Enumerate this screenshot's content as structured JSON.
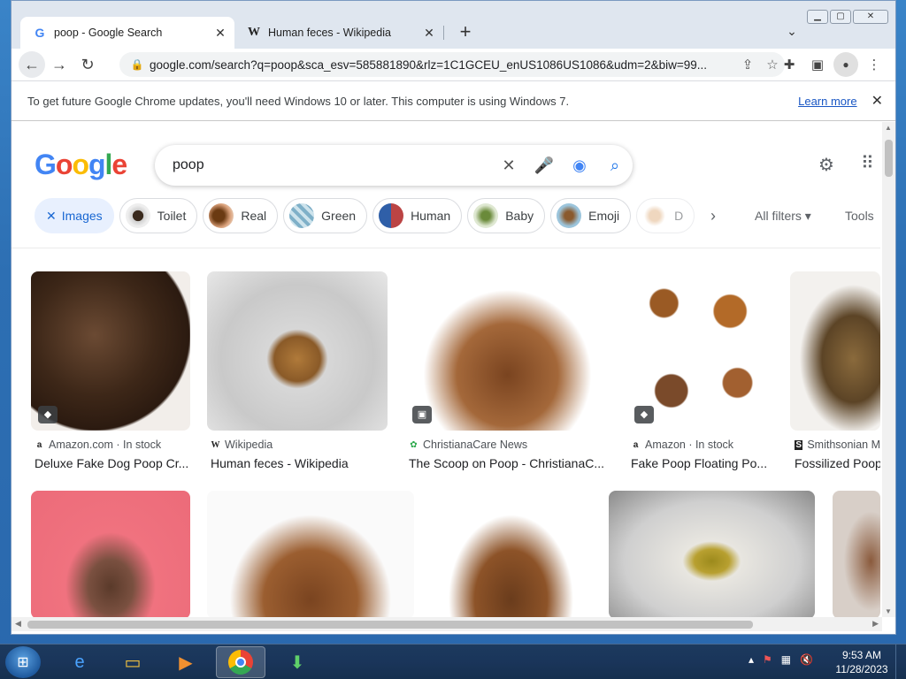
{
  "browser": {
    "tabs": [
      {
        "title": "poop - Google Search",
        "favicon": "G"
      },
      {
        "title": "Human feces - Wikipedia",
        "favicon": "W"
      }
    ],
    "url": "google.com/search?q=poop&sca_esv=585881890&rlz=1C1GCEU_enUS1086US1086&udm=2&biw=99...",
    "window_controls": [
      "_",
      "□",
      "✕"
    ]
  },
  "infobar": {
    "message": "To get future Google Chrome updates, you'll need Windows 10 or later. This computer is using Windows 7.",
    "link": "Learn more"
  },
  "search": {
    "query": "poop",
    "logo": "Google"
  },
  "chips": [
    {
      "label": "Images",
      "selected": true
    },
    {
      "label": "Toilet"
    },
    {
      "label": "Real"
    },
    {
      "label": "Green"
    },
    {
      "label": "Human"
    },
    {
      "label": "Baby"
    },
    {
      "label": "Emoji"
    },
    {
      "label": "D"
    }
  ],
  "filters": {
    "all_filters": "All filters",
    "tools": "Tools"
  },
  "results": [
    {
      "source": "Amazon.com · In stock",
      "title": "Deluxe Fake Dog Poop Cr...",
      "fav": "a"
    },
    {
      "source": "Wikipedia",
      "title": "Human feces - Wikipedia",
      "fav": "W"
    },
    {
      "source": "ChristianaCare News",
      "title": "The Scoop on Poop - ChristianaC...",
      "fav": "✿"
    },
    {
      "source": "Amazon · In stock",
      "title": "Fake Poop Floating Po...",
      "fav": "a"
    },
    {
      "source": "Smithsonian M",
      "title": "Fossilized Poop",
      "fav": "S"
    }
  ],
  "taskbar": {
    "time": "9:53 AM",
    "date": "11/28/2023"
  }
}
